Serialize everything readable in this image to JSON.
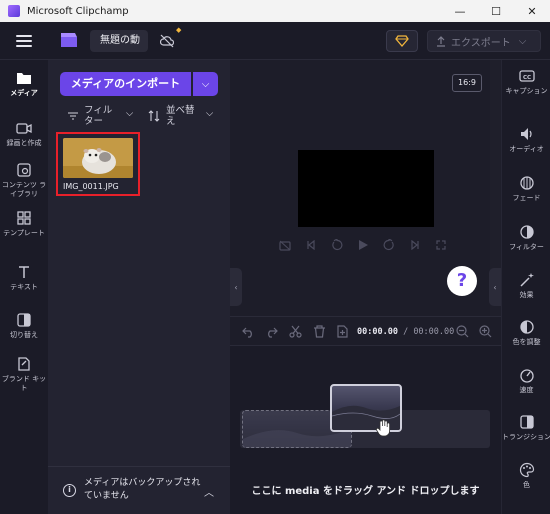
{
  "window": {
    "title": "Microsoft Clipchamp",
    "minimize": "—",
    "maximize": "☐",
    "close": "✕"
  },
  "topbar": {
    "project_name": "無題の動",
    "export_label": "エクスポート",
    "premium_icon": "diamond-icon",
    "accent_color": "#6b45e8",
    "premium_color": "#f2b63c"
  },
  "leftnav": {
    "items": [
      {
        "label": "メディア",
        "icon": "folder-icon"
      },
      {
        "label": "録画と作成",
        "icon": "camera-icon"
      },
      {
        "label": "コンテンツ ライブラリ",
        "icon": "library-icon"
      },
      {
        "label": "テンプレート",
        "icon": "templates-icon"
      },
      {
        "label": "テキスト",
        "icon": "text-icon"
      },
      {
        "label": "切り替え",
        "icon": "transitions-icon"
      },
      {
        "label": "ブランド キット",
        "icon": "brand-kit-icon"
      }
    ]
  },
  "media": {
    "import_label": "メディアのインポート",
    "filter_label": "フィルター",
    "sort_label": "並べ替え",
    "file_name": "IMG_0011.JPG",
    "backup_text": "メディアはバックアップされていません"
  },
  "preview": {
    "aspect_ratio": "16:9",
    "help": "?"
  },
  "timeline": {
    "current_time": "00:00.00",
    "total_time": "/ 00:00.00",
    "drop_hint": "ここに media をドラッグ アンド ドロップします"
  },
  "rightnav": {
    "items": [
      {
        "label": "キャプション",
        "icon": "captions-icon"
      },
      {
        "label": "オーディオ",
        "icon": "speaker-icon"
      },
      {
        "label": "フェード",
        "icon": "fade-icon"
      },
      {
        "label": "フィルター",
        "icon": "filter-icon"
      },
      {
        "label": "効果",
        "icon": "magic-wand-icon"
      },
      {
        "label": "色を調整",
        "icon": "color-adjust-icon"
      },
      {
        "label": "速度",
        "icon": "speed-icon"
      },
      {
        "label": "トランジション",
        "icon": "transition-icon"
      },
      {
        "label": "色",
        "icon": "palette-icon"
      }
    ]
  }
}
